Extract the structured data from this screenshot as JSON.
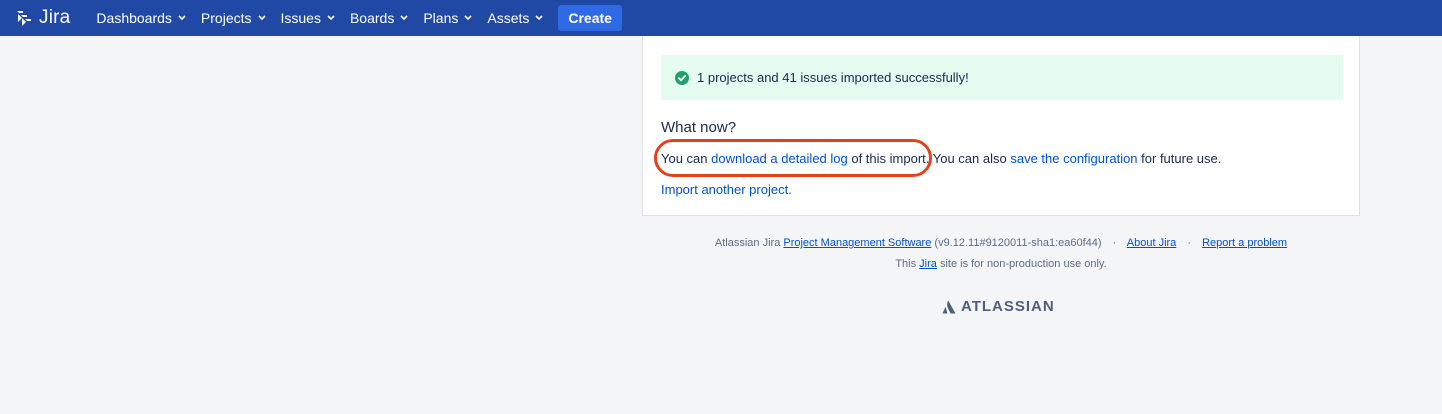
{
  "header": {
    "logo_text": "Jira",
    "nav": [
      {
        "label": "Dashboards"
      },
      {
        "label": "Projects"
      },
      {
        "label": "Issues"
      },
      {
        "label": "Boards"
      },
      {
        "label": "Plans"
      },
      {
        "label": "Assets"
      }
    ],
    "create_label": "Create"
  },
  "panel": {
    "success_message": "1 projects and 41 issues imported successfully!",
    "what_now_title": "What now?",
    "line1": {
      "prefix": "You can ",
      "download_link": "download a detailed log",
      "middle": " of this import. You can also ",
      "save_link": "save the configuration",
      "suffix": " for future use."
    },
    "import_another_link": "Import another project."
  },
  "footer": {
    "prefix": "Atlassian Jira ",
    "pms_link": "Project Management Software",
    "version": " (v9.12.11#9120011-sha1:ea60f44)",
    "sep": "·",
    "about_link": "About Jira",
    "report_link": "Report a problem",
    "row2_prefix": "This ",
    "row2_link": "Jira",
    "row2_suffix": " site is for non-production use only.",
    "brand": "ATLASSIAN"
  },
  "colors": {
    "header_bg": "#2049a6",
    "create_bg": "#2d6ae3",
    "success_bg": "#e3fcef",
    "success_icon": "#22a06b",
    "link": "#0052cc",
    "highlight_ring": "#e5401c"
  },
  "icons": {
    "logo": "jira-logo-icon",
    "chevron": "chevron-down-icon",
    "success": "check-circle-icon",
    "atlassian": "atlassian-logo-icon"
  }
}
